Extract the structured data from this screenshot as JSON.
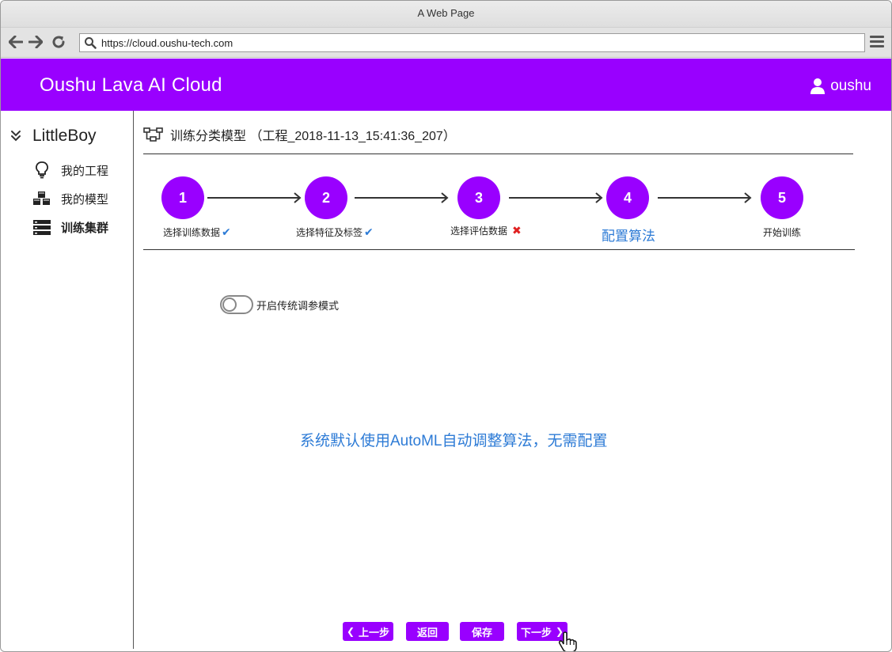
{
  "browser": {
    "title": "A Web Page",
    "url": "https://cloud.oushu-tech.com"
  },
  "header": {
    "app_title": "Oushu Lava AI Cloud",
    "username": "oushu"
  },
  "sidebar": {
    "group_name": "LittleBoy",
    "items": [
      {
        "label": "我的工程",
        "icon": "lightbulb-icon"
      },
      {
        "label": "我的模型",
        "icon": "cubes-icon"
      },
      {
        "label": "训练集群",
        "icon": "server-icon"
      }
    ]
  },
  "page": {
    "title": "训练分类模型 （工程_2018-11-13_15:41:36_207）"
  },
  "steps": [
    {
      "number": "1",
      "label": "选择训练数据",
      "status": "done"
    },
    {
      "number": "2",
      "label": "选择特征及标签",
      "status": "done"
    },
    {
      "number": "3",
      "label": "选择评估数据",
      "status": "error"
    },
    {
      "number": "4",
      "label": "配置算法",
      "status": "current"
    },
    {
      "number": "5",
      "label": "开始训练",
      "status": "pending"
    }
  ],
  "toggle": {
    "label": "开启传统调参模式",
    "on": false
  },
  "info_message": "系统默认使用AutoML自动调整算法，无需配置",
  "buttons": {
    "prev": "上一步",
    "back": "返回",
    "save": "保存",
    "next": "下一步"
  },
  "colors": {
    "brand": "#9900ff",
    "accent_text": "#2d7bd6",
    "error": "#e02020"
  }
}
